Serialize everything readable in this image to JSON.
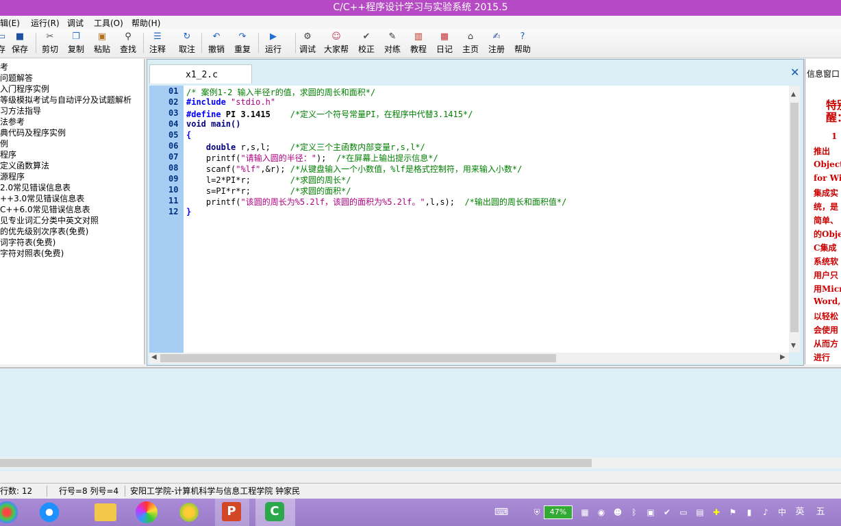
{
  "window": {
    "title": "C/C++程序设计学习与实验系统 2015.5"
  },
  "menu": [
    "辑(E)",
    "运行(R)",
    "调试",
    "工具(O)",
    "帮助(H)"
  ],
  "toolbar": [
    {
      "label": "存",
      "icon": "new-icon"
    },
    {
      "label": "保存",
      "icon": "save-icon"
    },
    {
      "label": "剪切",
      "icon": "cut-icon"
    },
    {
      "label": "复制",
      "icon": "copy-icon"
    },
    {
      "label": "粘贴",
      "icon": "paste-icon"
    },
    {
      "label": "查找",
      "icon": "find-icon"
    },
    {
      "label": "注释",
      "icon": "comment-icon"
    },
    {
      "label": "取注",
      "icon": "uncomment-icon"
    },
    {
      "label": "撤销",
      "icon": "undo-icon"
    },
    {
      "label": "重复",
      "icon": "redo-icon"
    },
    {
      "label": "运行",
      "icon": "run-icon"
    },
    {
      "label": "调试",
      "icon": "debug-icon"
    },
    {
      "label": "大家帮",
      "icon": "people-icon"
    },
    {
      "label": "校正",
      "icon": "check-icon"
    },
    {
      "label": "对练",
      "icon": "practice-icon"
    },
    {
      "label": "教程",
      "icon": "book-icon"
    },
    {
      "label": "日记",
      "icon": "diary-icon"
    },
    {
      "label": "主页",
      "icon": "home-icon"
    },
    {
      "label": "注册",
      "icon": "register-icon"
    },
    {
      "label": "帮助",
      "icon": "help-icon"
    }
  ],
  "tree": [
    "考",
    "问题解答",
    "入门程序实例",
    "等级模拟考试与自动评分及试题解析",
    "习方法指导",
    "法参考",
    "典代码及程序实例",
    "例",
    "程序",
    "定义函数算法",
    "源程序",
    "2.0常见错误信息表",
    "++3.0常见错误信息表",
    "C++6.0常见错误信息表",
    "见专业词汇分类中英文对照",
    "的优先级别次序表(免费)",
    "词字符表(免费)",
    "字符对照表(免费)"
  ],
  "editor": {
    "tab": "x1_2.c",
    "close": "✕",
    "line_numbers": [
      "01",
      "02",
      "03",
      "04",
      "05",
      "06",
      "07",
      "08",
      "09",
      "10",
      "11",
      "12"
    ],
    "code": {
      "l01": "/* 案例1-2 输入半径r的值，求圆的周长和面积*/",
      "l02a": "#include",
      "l02b": " \"stdio.h\"",
      "l03a": "#define",
      "l03b": " PI 3.1415",
      "l03c": "    /*定义一个符号常量PI，在程序中代替3.1415*/",
      "l04": "void main()",
      "l05": "{",
      "l06a": "    double",
      "l06b": " r,s,l;",
      "l06c": "    /*定义三个主函数内部变量r,s,l*/",
      "l07a": "    printf(",
      "l07b": "\"请输入圆的半径：\"",
      "l07c": ");",
      "l07d": "  /*在屏幕上输出提示信息*/",
      "l08a": "    scanf(",
      "l08b": "\"%lf\"",
      "l08c": ",&r);",
      "l08d": " /*从键盘输入一个小数值，%lf是格式控制符，用来输入小数*/",
      "l09a": "    l=2*PI*r;",
      "l09b": "        /*求圆的周长*/",
      "l10a": "    s=PI*r*r;",
      "l10b": "        /*求圆的面积*/",
      "l11a": "    printf(",
      "l11b": "\"该圆的周长为%5.2lf，该圆的面积为%5.2lf。\"",
      "l11c": ",l,s);",
      "l11d": "  /*输出圆的周长和面积值*/",
      "l12": "}"
    }
  },
  "info": {
    "title": "信息窗口",
    "lines": [
      "特别",
      "醒：",
      "1",
      "推出",
      "Objecti",
      "for Win",
      "集成实",
      "统，是",
      "简单、",
      "的Obje",
      "C集成",
      "系统软",
      "用户只",
      "用Micr",
      "Word,",
      "以轻松",
      "会使用",
      "从而方",
      "进行"
    ]
  },
  "status": {
    "lines": "行数:  12",
    "position": "行号=8  列号=4",
    "org": "安阳工学院-计算机科学与信息工程学院   钟家民"
  },
  "tray": {
    "battery": "47%",
    "ime1": "中",
    "ime2": "英",
    "ime3": "五"
  }
}
